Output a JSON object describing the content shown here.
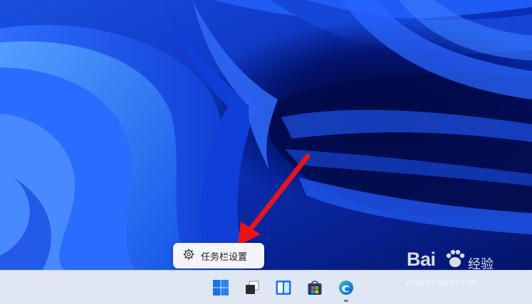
{
  "context_menu": {
    "items": [
      {
        "label": "任务栏设置",
        "icon": "gear-icon"
      }
    ]
  },
  "taskbar": {
    "apps": [
      {
        "name": "start",
        "icon": "windows-start-icon"
      },
      {
        "name": "task-view",
        "icon": "task-view-icon"
      },
      {
        "name": "widgets",
        "icon": "widgets-icon"
      },
      {
        "name": "store",
        "icon": "store-icon"
      },
      {
        "name": "edge",
        "icon": "edge-icon",
        "running": true
      }
    ]
  },
  "annotation": {
    "arrow_color": "#e8141b"
  },
  "watermark": {
    "logo_text": "Bai",
    "suffix_text": "经验",
    "url": "jingyan.baidu.com"
  },
  "colors": {
    "wallpaper_base": "#0a2fb0",
    "taskbar_bg": "#dfe6f4",
    "menu_bg": "#f3f5fb",
    "accent_blue": "#1a73e8"
  }
}
